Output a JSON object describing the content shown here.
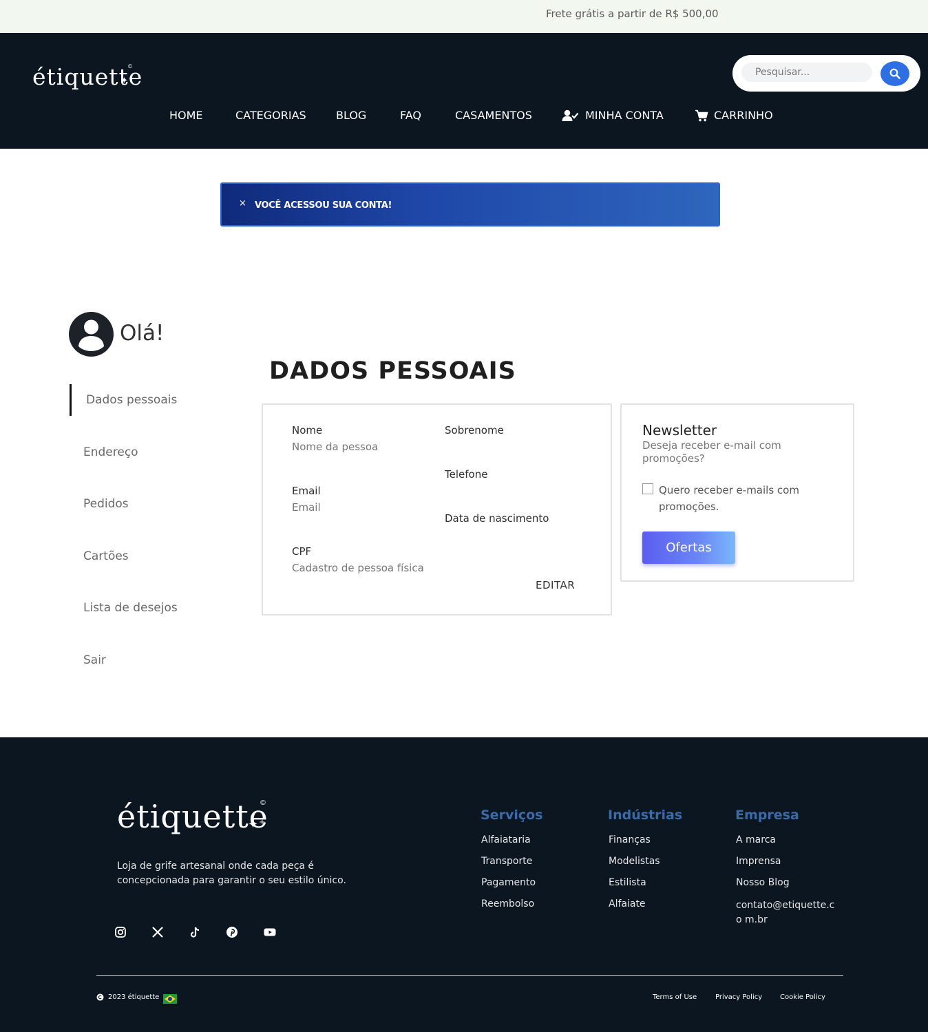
{
  "topbar": {
    "promo": "Frete grátis a partir de R$ 500,00"
  },
  "header": {
    "logo_text": "étiquette",
    "search_placeholder": "Pesquisar...",
    "nav": [
      {
        "label": "HOME"
      },
      {
        "label": "CATEGORIAS"
      },
      {
        "label": "BLOG"
      },
      {
        "label": "FAQ"
      },
      {
        "label": "CASAMENTOS"
      },
      {
        "label": "MINHA CONTA",
        "icon": "user-check-icon"
      },
      {
        "label": "CARRINHO",
        "icon": "cart-icon"
      }
    ]
  },
  "alert": {
    "close": "×",
    "message": "VOCÊ ACESSOU SUA CONTA!"
  },
  "greeting": "Olá!",
  "sidebar": {
    "items": [
      {
        "label": "Dados pessoais",
        "active": true
      },
      {
        "label": "Endereço"
      },
      {
        "label": "Pedidos"
      },
      {
        "label": "Cartões"
      },
      {
        "label": "Lista de desejos"
      },
      {
        "label": "Sair"
      }
    ]
  },
  "main": {
    "title": "DADOS PESSOAIS",
    "personal": {
      "nome_label": "Nome",
      "nome_value": "Nome da pessoa",
      "sobrenome_label": "Sobrenome",
      "telefone_label": "Telefone",
      "email_label": "Email",
      "email_value": "Email",
      "nascimento_label": "Data de nascimento",
      "cpf_label": "CPF",
      "cpf_value": "Cadastro de pessoa física",
      "edit_label": "EDITAR"
    },
    "newsletter": {
      "title": "Newsletter",
      "subtitle": "Deseja receber e-mail com promoções?",
      "checkbox_label": "Quero receber e-mails com promoções.",
      "checked": false,
      "button_label": "Ofertas"
    }
  },
  "footer": {
    "logo_text": "étiquette",
    "description": "Loja de grife artesanal onde cada peça é concepcionada para garantir o seu estilo único.",
    "social": [
      "instagram-icon",
      "x-icon",
      "tiktok-icon",
      "pinterest-icon",
      "youtube-icon"
    ],
    "columns": [
      {
        "title": "Serviços",
        "links": [
          "Alfaiataria",
          "Transporte",
          "Pagamento",
          "Reembolso"
        ]
      },
      {
        "title": "Indústrias",
        "links": [
          "Finanças",
          "Modelistas",
          "Estilista",
          "Alfaiate"
        ]
      },
      {
        "title": "Empresa",
        "links": [
          "A marca",
          "Imprensa",
          "Nosso Blog",
          "contato@etiquette.co m.br"
        ]
      }
    ],
    "copyright": "2023 étiquette",
    "legal": [
      "Terms of Use",
      "Privacy Policy",
      "Cookie Policy"
    ],
    "colors": {
      "background": "#0c1620",
      "column_heading": "#3b6aa8"
    }
  },
  "colors": {
    "header_bg": "#0c1620",
    "accent_blue": "#2f6fe4",
    "topbar_bg": "#f2f8ef"
  }
}
